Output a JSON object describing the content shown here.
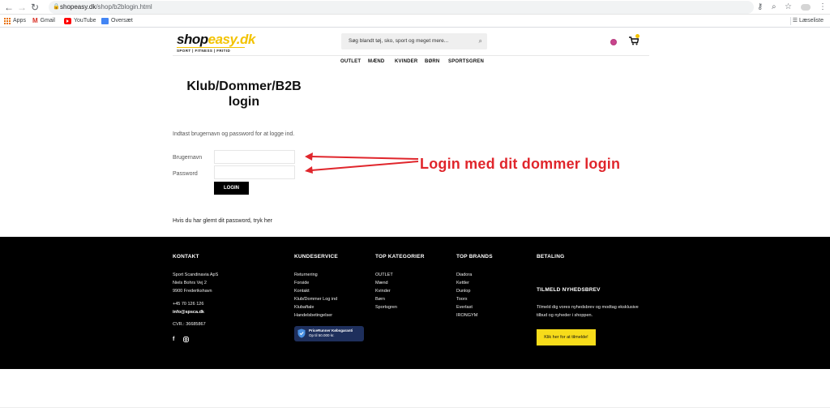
{
  "browser": {
    "url_domain": "shopeasy.dk",
    "url_path": "/shop/b2blogin.html",
    "bookmarks": [
      {
        "label": "Apps"
      },
      {
        "label": "Gmail"
      },
      {
        "label": "YouTube"
      },
      {
        "label": "Oversæt"
      }
    ],
    "reading_list": "Læseliste"
  },
  "header": {
    "logo_shop": "shop",
    "logo_easy": "easy.dk",
    "logo_tagline": "SPORT | FITNESS | FRITID",
    "search_placeholder": "Søg blandt tøj, sko, sport og meget mere...",
    "cart_count": "0"
  },
  "nav": {
    "items": [
      {
        "label": "OUTLET"
      },
      {
        "label": "MÆND"
      },
      {
        "label": "KVINDER"
      },
      {
        "label": "BØRN"
      },
      {
        "label": "SPORTSGREN"
      }
    ]
  },
  "login": {
    "title_line1": "Klub/Dommer/B2B",
    "title_line2": "login",
    "intro": "Indtast brugernavn og password for at logge ind.",
    "username_label": "Brugernavn",
    "password_label": "Password",
    "button_label": "LOGIN",
    "forgot": "Hvis du har glemt dit password, tryk her"
  },
  "annotation": {
    "text": "Login med dit dommer login",
    "color": "#e0262c"
  },
  "footer": {
    "kontakt": {
      "title": "KONTAKT",
      "company": "Sport Scandinavia ApS",
      "street": "Niels Bohrs Vej 2",
      "city": "9900 Frederikshavn",
      "phone": "+45 70 126 126",
      "email": "info@spsca.dk",
      "cvr": "CVR.: 36685867"
    },
    "kundeservice": {
      "title": "KUNDESERVICE",
      "items": [
        "Returnering",
        "Forside",
        "Kontakt",
        "Klub/Dommer Log ind",
        "Klubaftale",
        "Handelsbetingelser"
      ],
      "badge_line1": "PriceRunner Købsgaranti",
      "badge_line2": "Op til 50.000 kr."
    },
    "top_kategorier": {
      "title": "TOP KATEGORIER",
      "items": [
        "OUTLET",
        "Mænd",
        "Kvinder",
        "Børn",
        "Sportsgren"
      ]
    },
    "top_brands": {
      "title": "TOP BRANDS",
      "items": [
        "Diadora",
        "Kettler",
        "Dunlop",
        "Toorx",
        "Everlast",
        "IRONGYM"
      ]
    },
    "betaling": {
      "title": "BETALING"
    },
    "newsletter": {
      "title": "TILMELD NYHEDSBREV",
      "text_line1": "Tilmeld dig vores nyhedsbrev og modtag eksklusive",
      "text_line2": "tilbud og nyheder i shoppen.",
      "button": "Klik her for at tilmelde!",
      "button_color": "#f7dc1a"
    }
  }
}
